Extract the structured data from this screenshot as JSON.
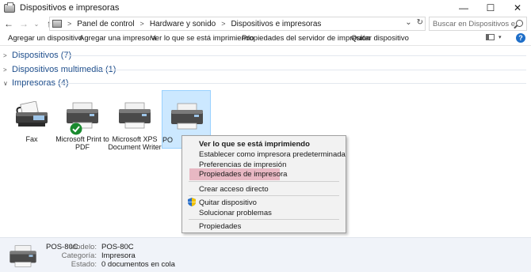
{
  "window": {
    "title": "Dispositivos e impresoras",
    "controls": {
      "minimize": "—",
      "maximize": "☐",
      "close": "✕"
    }
  },
  "address": {
    "back": "←",
    "forward": "→",
    "dropdown": "⌄",
    "up": "↑",
    "breadcrumb": [
      "Panel de control",
      "Hardware y sonido",
      "Dispositivos e impresoras"
    ],
    "sep": ">",
    "dropdown_glyph": "⌄",
    "refresh": "↻",
    "search_placeholder": "Buscar en Dispositivos e impr..."
  },
  "commands": {
    "add_device": "Agregar un dispositivo",
    "add_printer": "Agregar una impresora",
    "see_printing": "Ver lo que se está imprimiendo",
    "server_props": "Propiedades del servidor de impresión",
    "remove_device": "Quitar dispositivo",
    "view_caret": "▾",
    "help": "?"
  },
  "groups": {
    "devices": {
      "label": "Dispositivos (7)",
      "chev": ">"
    },
    "multimedia": {
      "label": "Dispositivos multimedia (1)",
      "chev": ">"
    },
    "printers": {
      "label": "Impresoras (4)",
      "chev": "∨"
    }
  },
  "printers": [
    {
      "name": "Fax",
      "icon": "fax-icon"
    },
    {
      "name": "Microsoft Print to PDF",
      "icon": "printer-icon",
      "default": true
    },
    {
      "name": "Microsoft XPS Document Writer",
      "icon": "printer-icon"
    },
    {
      "name": "PO",
      "icon": "printer-icon",
      "selected": true
    }
  ],
  "context_menu": {
    "items": [
      {
        "label": "Ver lo que se está imprimiendo",
        "bold": true
      },
      {
        "label": "Establecer como impresora predeterminada"
      },
      {
        "label": "Preferencias de impresión"
      },
      {
        "label": "Propiedades de impresora",
        "highlighted": true
      },
      {
        "label": "Crear acceso directo"
      },
      {
        "label": "Quitar dispositivo",
        "icon": "shield-icon"
      },
      {
        "label": "Solucionar problemas"
      },
      {
        "label": "Propiedades"
      }
    ]
  },
  "details": {
    "name": "POS-80C",
    "model_label": "Modelo:",
    "model_value": "POS-80C",
    "category_label": "Categoría:",
    "category_value": "Impresora",
    "status_label": "Estado:",
    "status_value": "0 documentos en cola"
  },
  "colors": {
    "group_header": "#1e4e8c",
    "selection": "#cce8ff",
    "menu_highlight": "#e8b8c3",
    "default_badge": "#1a8a2f"
  }
}
